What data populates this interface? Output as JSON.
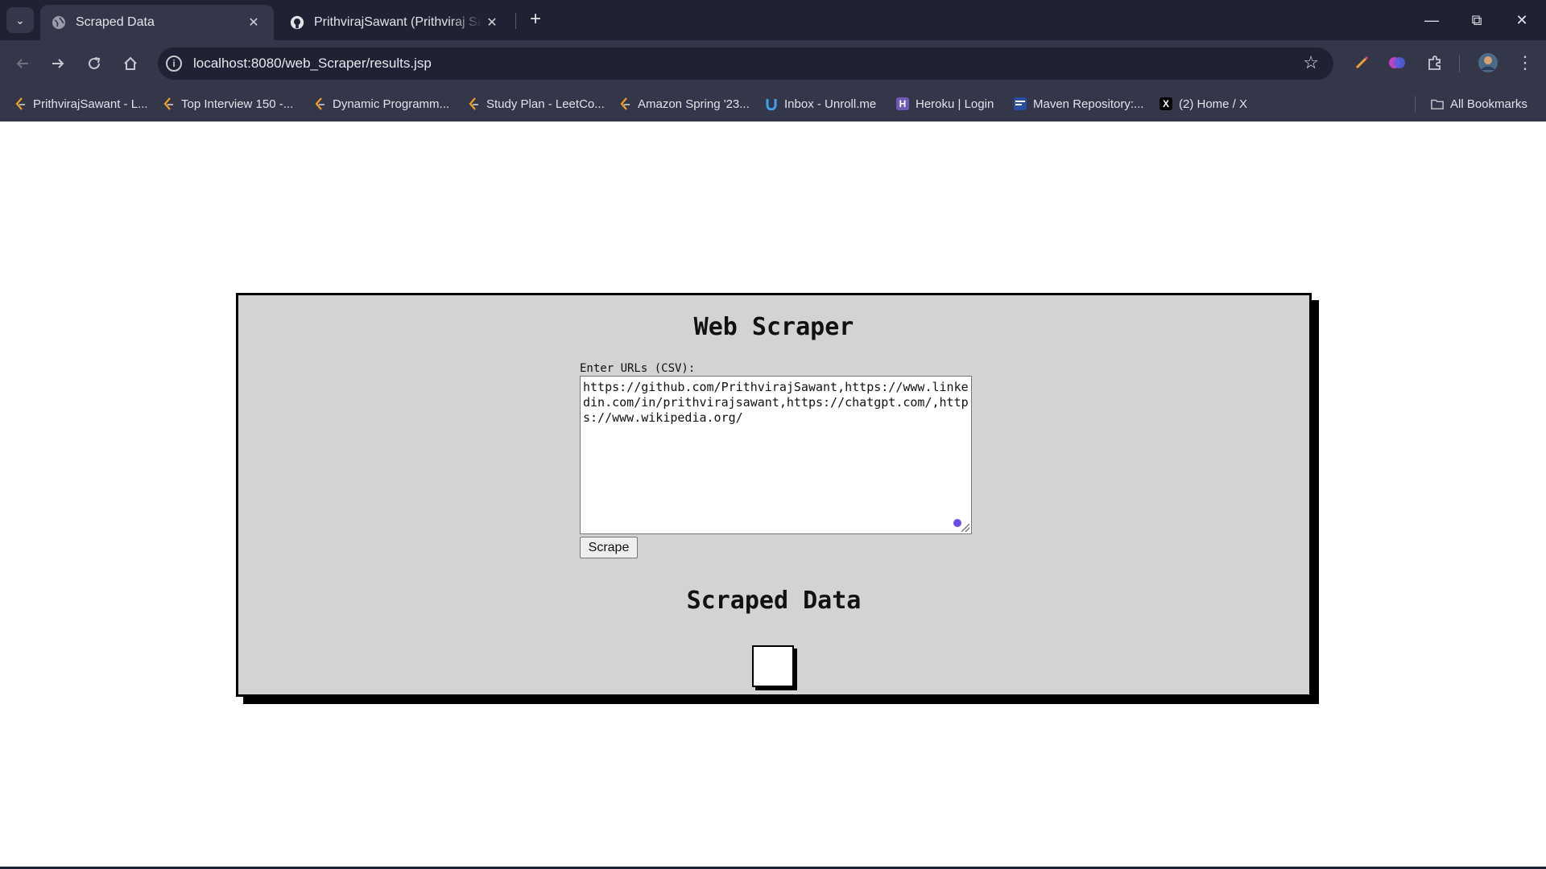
{
  "browser": {
    "tabs": [
      {
        "title": "Scraped Data",
        "active": true
      },
      {
        "title": "PrithvirajSawant (Prithviraj Sawant)",
        "active": false
      }
    ],
    "url": "localhost:8080/web_Scraper/results.jsp",
    "bookmarks": [
      {
        "label": "PrithvirajSawant - L...",
        "icon": "leetcode-icon"
      },
      {
        "label": "Top Interview 150 -...",
        "icon": "leetcode-icon"
      },
      {
        "label": "Dynamic Programm...",
        "icon": "leetcode-icon"
      },
      {
        "label": "Study Plan - LeetCo...",
        "icon": "leetcode-icon"
      },
      {
        "label": "Amazon Spring '23...",
        "icon": "leetcode-icon"
      },
      {
        "label": "Inbox - Unroll.me",
        "icon": "unrollme-icon"
      },
      {
        "label": "Heroku | Login",
        "icon": "heroku-icon"
      },
      {
        "label": "Maven Repository:...",
        "icon": "maven-icon"
      },
      {
        "label": "(2) Home / X",
        "icon": "x-icon"
      }
    ],
    "all_bookmarks": "All Bookmarks",
    "colors": {
      "chrome_dark": "#1f2233",
      "chrome_mid": "#34374a"
    }
  },
  "page": {
    "title": "Web Scraper",
    "input_label": "Enter URLs (CSV):",
    "textarea_value": "https://github.com/PrithvirajSawant,https://www.linkedin.com/in/prithvirajsawant,https://chatgpt.com/,https://www.wikipedia.org/",
    "scrape_button": "Scrape",
    "results_title": "Scraped Data",
    "colors": {
      "card_bg": "#d3d3d3",
      "border": "#000000"
    }
  }
}
